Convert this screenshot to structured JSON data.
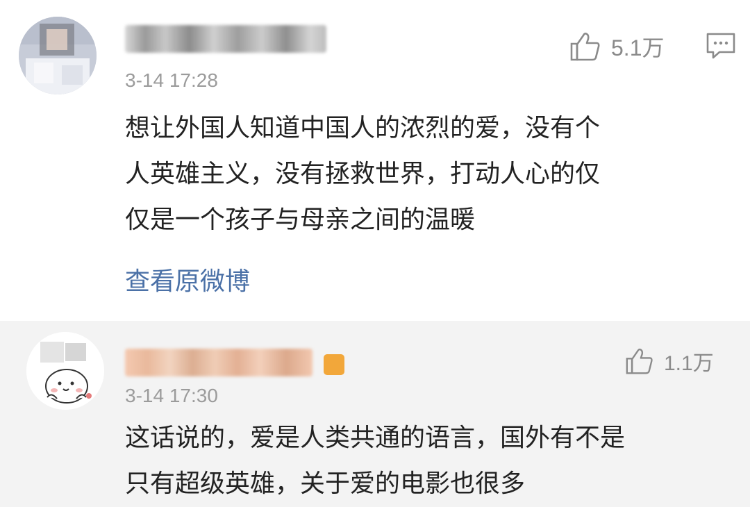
{
  "comments": [
    {
      "time": "3-14 17:28",
      "likes": "5.1万",
      "content_lines": [
        "想让外国人知道中国人的浓烈的爱，没有个",
        "人英雄主义，没有拯救世界，打动人心的仅",
        "仅是一个孩子与母亲之间的温暖"
      ],
      "view_original": "查看原微博",
      "icons": [
        "thumbs-up-icon",
        "comment-icon"
      ]
    },
    {
      "time": "3-14 17:30",
      "likes": "1.1万",
      "content_lines": [
        "这话说的，爱是人类共通的语言，国外有不是",
        "只有超级英雄，关于爱的电影也很多"
      ],
      "icons": [
        "thumbs-up-icon"
      ]
    }
  ],
  "colors": {
    "link": "#4b71a7",
    "meta": "#9b9b9b",
    "text": "#222222",
    "second_bg": "#f3f3f3",
    "badge": "#f2a73a"
  }
}
